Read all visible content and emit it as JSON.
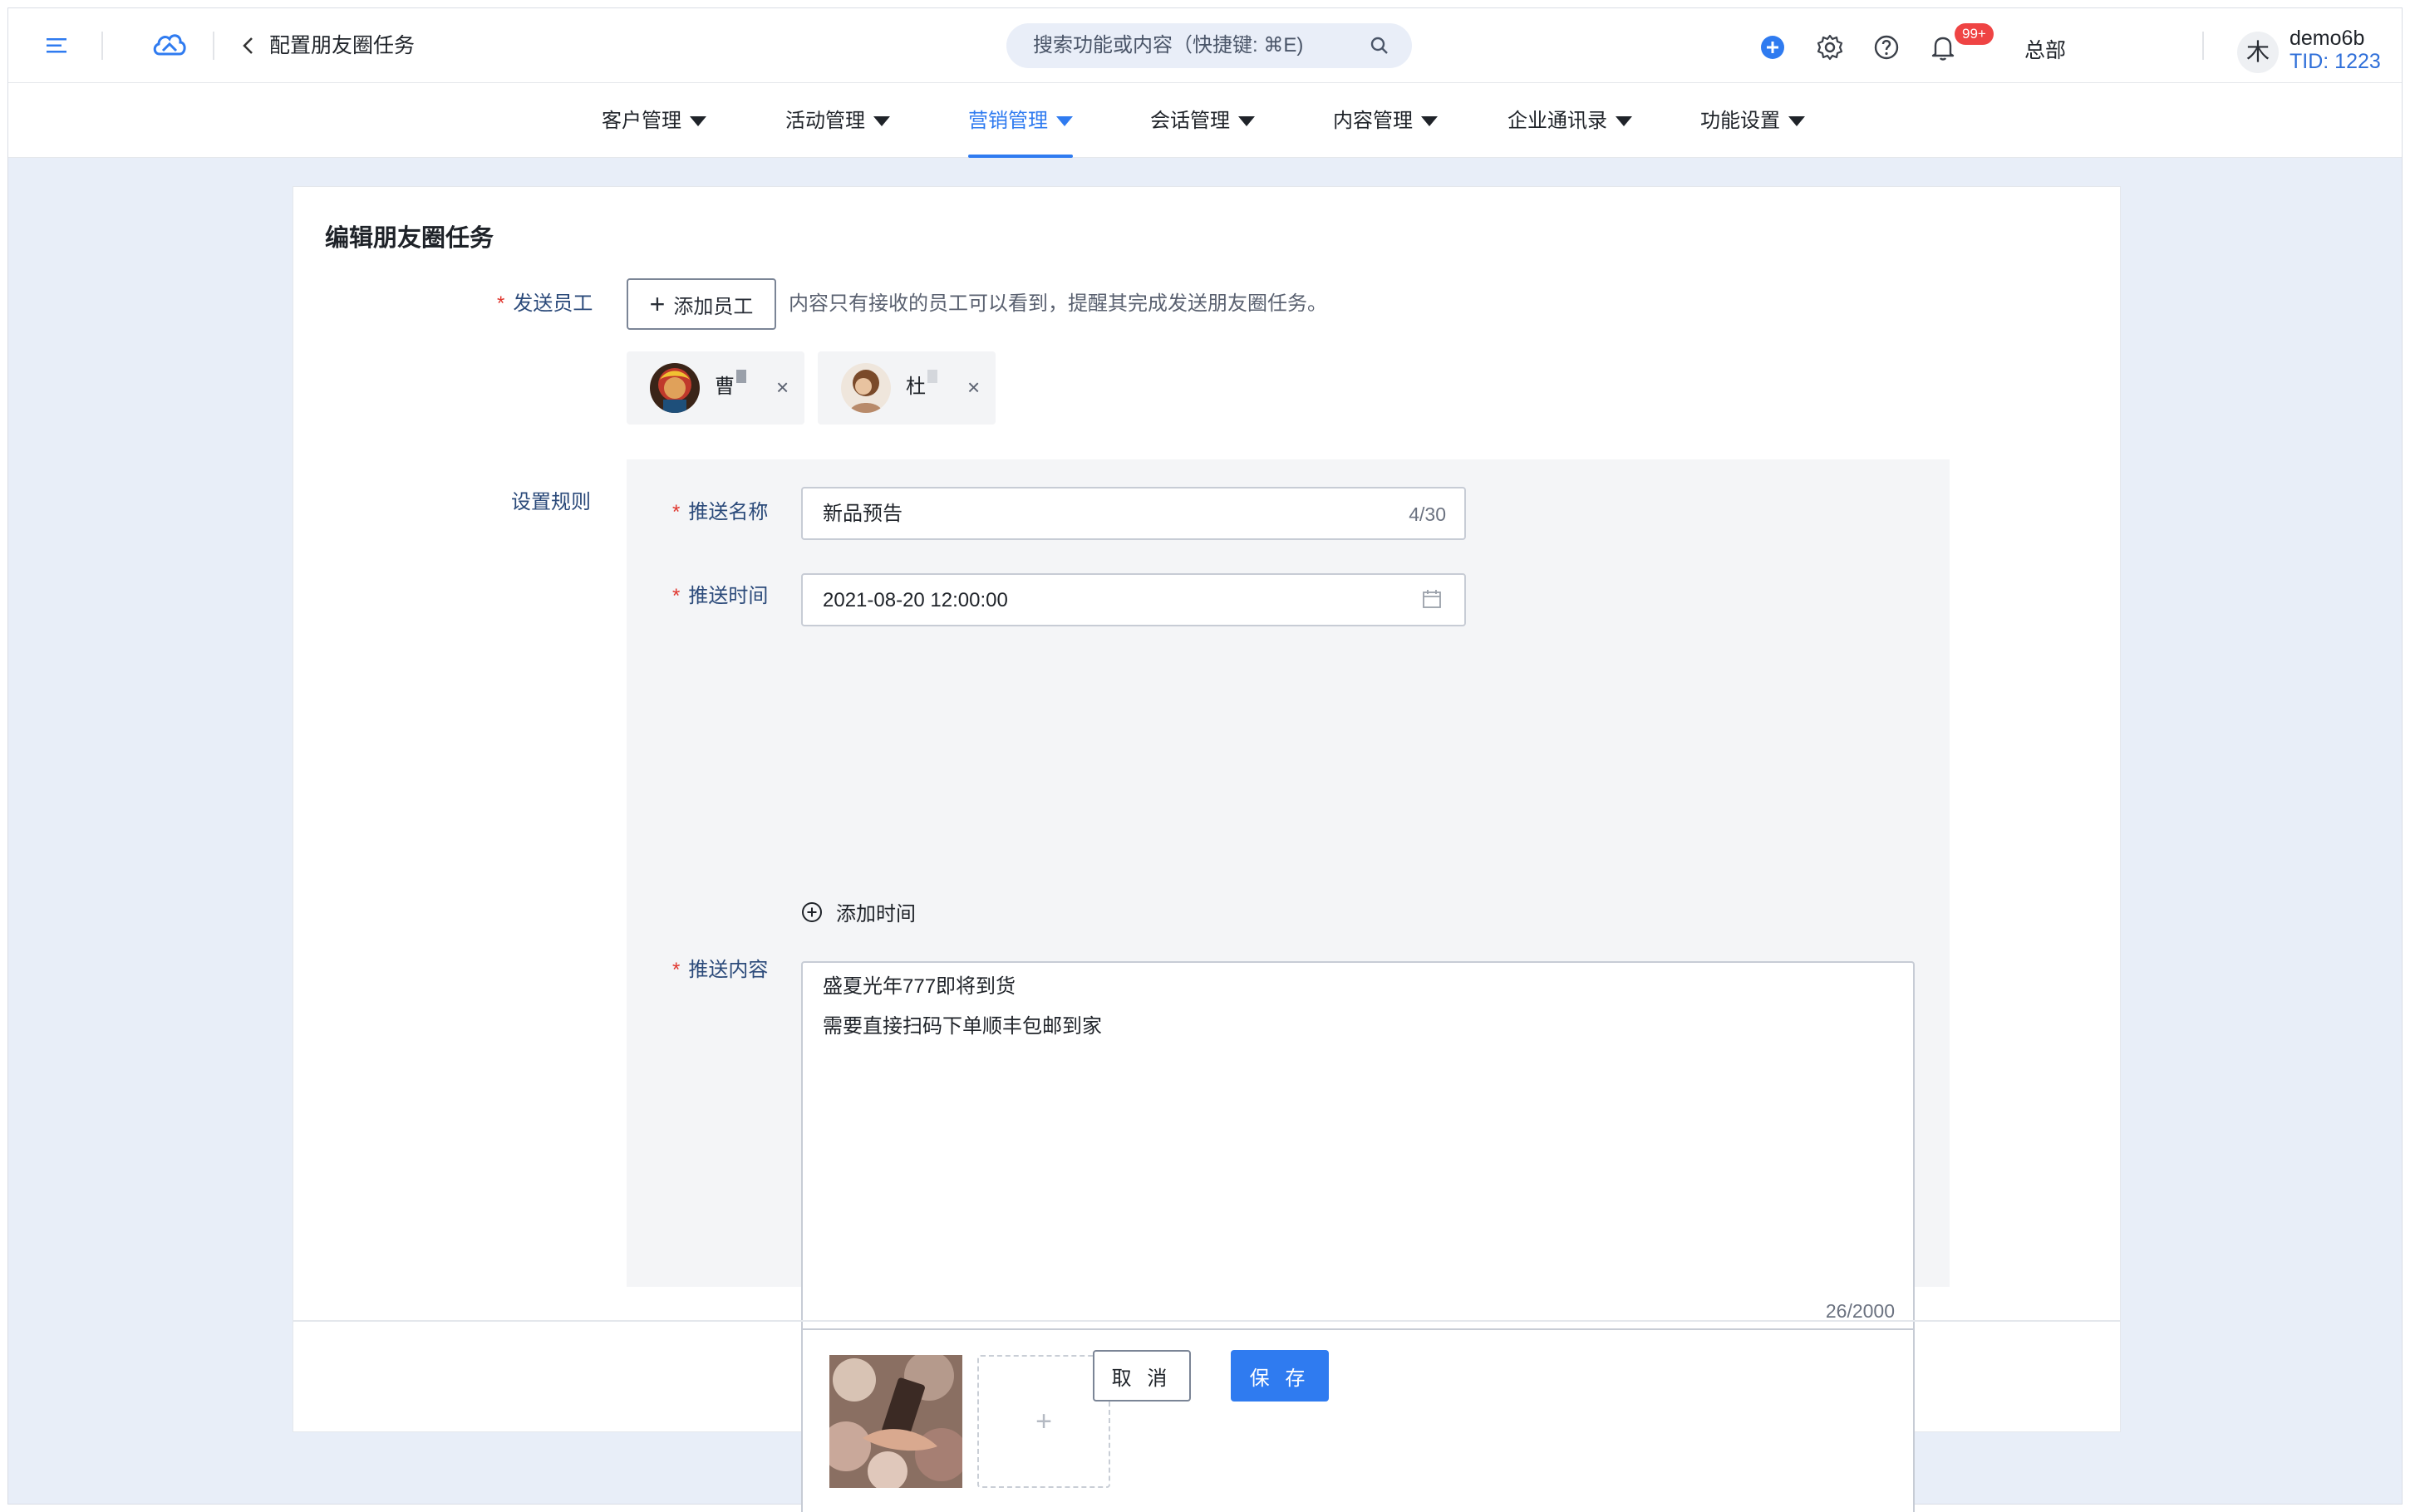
{
  "header": {
    "page_title": "配置朋友圈任务",
    "search_placeholder": "搜索功能或内容（快捷键: ⌘E)",
    "notification_badge": "99+",
    "org_label": "总部",
    "avatar_initial": "木",
    "user_name": "demo6b",
    "user_tid": "TID: 1223"
  },
  "nav": {
    "items": [
      {
        "label": "客户管理"
      },
      {
        "label": "活动管理"
      },
      {
        "label": "营销管理",
        "active": true
      },
      {
        "label": "会话管理"
      },
      {
        "label": "内容管理"
      },
      {
        "label": "企业通讯录"
      },
      {
        "label": "功能设置"
      }
    ]
  },
  "form": {
    "card_title": "编辑朋友圈任务",
    "send_staff_label": "发送员工",
    "add_staff_button": "添加员工",
    "staff_hint": "内容只有接收的员工可以看到，提醒其完成发送朋友圈任务。",
    "staff": [
      {
        "name": "曹"
      },
      {
        "name": "杜"
      }
    ],
    "rules_label": "设置规则",
    "push_name_label": "推送名称",
    "push_name_value": "新品预告",
    "push_name_count": "4/30",
    "push_time_label": "推送时间",
    "push_time_value": "2021-08-20 12:00:00",
    "add_time_label": "添加时间",
    "push_content_label": "推送内容",
    "content_lines": [
      "盛夏光年777即将到货",
      "需要直接扫码下单顺丰包邮到家"
    ],
    "content_count": "26/2000",
    "upload_plus": "+"
  },
  "footer": {
    "cancel_label": "取 消",
    "save_label": "保 存"
  },
  "colors": {
    "accent": "#2f7bf0",
    "required": "#e0362e",
    "page_bg": "#e8eef8"
  }
}
